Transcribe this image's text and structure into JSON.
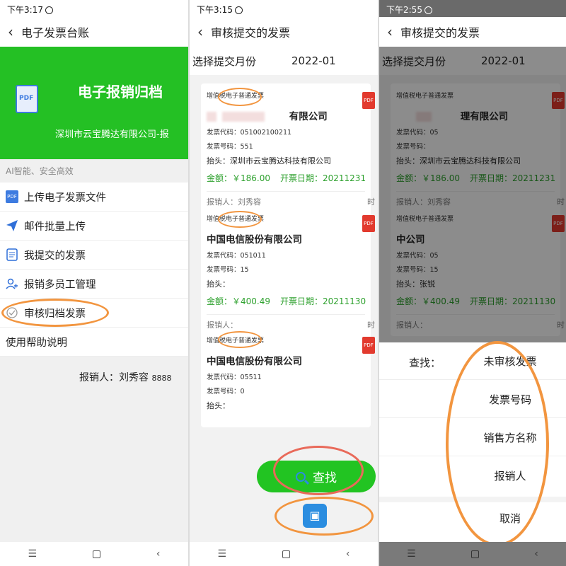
{
  "panel1": {
    "status_time": "下午3:17",
    "title": "电子发票台账",
    "banner_title": "电子报销归档",
    "banner_company": "深圳市云宝腾达有限公司-报",
    "pdf_label": "PDF",
    "tagline": "AI智能、安全高效",
    "menu": [
      {
        "label": "上传电子发票文件",
        "icon": "pdf-icon"
      },
      {
        "label": "邮件批量上传",
        "icon": "paper-plane-icon"
      },
      {
        "label": "我提交的发票",
        "icon": "document-icon"
      },
      {
        "label": "报销多员工管理",
        "icon": "users-icon"
      },
      {
        "label": "审核归档发票",
        "icon": "check-icon"
      },
      {
        "label": "使用帮助说明",
        "icon": ""
      }
    ],
    "submitter_label": "报销人：刘秀容",
    "submitter_code": "8888"
  },
  "panel2": {
    "status_time": "下午3:15",
    "title": "审核提交的发票",
    "month_label": "选择提交月份",
    "month_value": "2022-01",
    "cards": [
      {
        "type": "增值税电子普通发票",
        "seller": "有限公司",
        "code": "发票代码：051002100211",
        "number": "发票号码：551",
        "header": "抬头：深圳市云宝腾达科技有限公司",
        "amount": "金额：￥186.00",
        "date": "开票日期：20211231",
        "submitter": "报销人：刘秀容",
        "time": "时"
      },
      {
        "type": "增值税电子普通发票",
        "seller": "中国电信股份有限公司",
        "code": "发票代码：051011",
        "number": "发票号码：15",
        "header": "抬头：",
        "amount": "金额：￥400.49",
        "date": "开票日期：20211130",
        "submitter": "报销人：",
        "time": "时"
      },
      {
        "type": "增值税电子普通发票",
        "seller": "中国电信股份有限公司",
        "code": "发票代码：05511",
        "number": "发票号码：0",
        "header": "抬头：",
        "amount": "",
        "date": "",
        "submitter": "",
        "time": ""
      }
    ],
    "find_button": "查找",
    "pdf_badge": "PDF"
  },
  "panel3": {
    "status_time": "下午2:55",
    "title": "审核提交的发票",
    "month_label": "选择提交月份",
    "month_value": "2022-01",
    "cards": [
      {
        "type": "增值税电子普通发票",
        "seller": "理有限公司",
        "code": "发票代码：05",
        "number": "发票号码：",
        "header": "抬头：深圳市云宝腾达科技有限公司",
        "amount": "金额：￥186.00",
        "date": "开票日期：20211231",
        "submitter": "报销人：刘秀容",
        "time": "时"
      },
      {
        "type": "增值税电子普通发票",
        "seller": "中公司",
        "code": "发票代码：05",
        "number": "发票号码：15",
        "header": "抬头：张锐",
        "amount": "金额：￥400.49",
        "date": "开票日期：20211130",
        "submitter": "报销人：",
        "time": "时"
      }
    ],
    "sheet": {
      "label": "查找：",
      "options": [
        "未审核发票",
        "发票号码",
        "销售方名称",
        "报销人",
        "取消"
      ]
    }
  },
  "colors": {
    "green": "#24c024",
    "orange": "#f2953f",
    "blue": "#2b8de0",
    "pdf_red": "#e23a2e"
  }
}
